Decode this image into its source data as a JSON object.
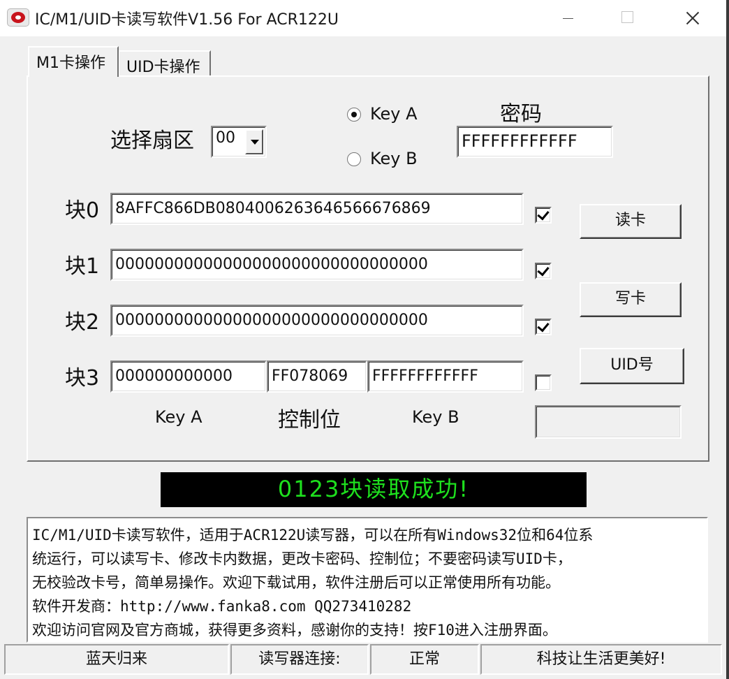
{
  "window": {
    "title": "IC/M1/UID卡读写软件V1.56 For ACR122U"
  },
  "tabs": [
    {
      "label": "M1卡操作",
      "active": true
    },
    {
      "label": "UID卡操作",
      "active": false
    }
  ],
  "sector": {
    "label": "选择扇区",
    "value": "00"
  },
  "key_select": {
    "options": [
      "Key A",
      "Key B"
    ],
    "selected": "Key A"
  },
  "password": {
    "label": "密码",
    "value": "FFFFFFFFFFFF"
  },
  "blocks": [
    {
      "label": "块0",
      "value": "8AFFC866DB0804006263646566676869",
      "checked": true
    },
    {
      "label": "块1",
      "value": "00000000000000000000000000000000",
      "checked": true
    },
    {
      "label": "块2",
      "value": "00000000000000000000000000000000",
      "checked": true
    }
  ],
  "block3": {
    "label": "块3",
    "key_a": "000000000000",
    "control_bits": "FF078069",
    "key_b": "FFFFFFFFFFFF",
    "checked": false
  },
  "block3_captions": {
    "key_a": "Key A",
    "control": "控制位",
    "key_b": "Key B"
  },
  "buttons": {
    "read": "读卡",
    "write": "写卡",
    "uid": "UID号"
  },
  "uid_output": "",
  "status_message": "0123块读取成功!",
  "info_text": [
    "IC/M1/UID卡读写软件，适用于ACR122U读写器，可以在所有Windows32位和64位系",
    "统运行，可以读写卡、修改卡内数据，更改卡密码、控制位；不要密码读写UID卡，",
    "无校验改卡号，简单易操作。欢迎下载试用，软件注册后可以正常使用所有功能。",
    "软件开发商：http://www.fanka8.com QQ273410282",
    "欢迎访问官网及官方商城，获得更多资料，感谢你的支持！按F10进入注册界面。"
  ],
  "statusbar": [
    "蓝天归来",
    "读写器连接:",
    "正常",
    "科技让生活更美好!"
  ],
  "colors": {
    "status_bg": "#000000",
    "status_text": "#1ee01e",
    "window_bg": "#f0f0f0"
  }
}
